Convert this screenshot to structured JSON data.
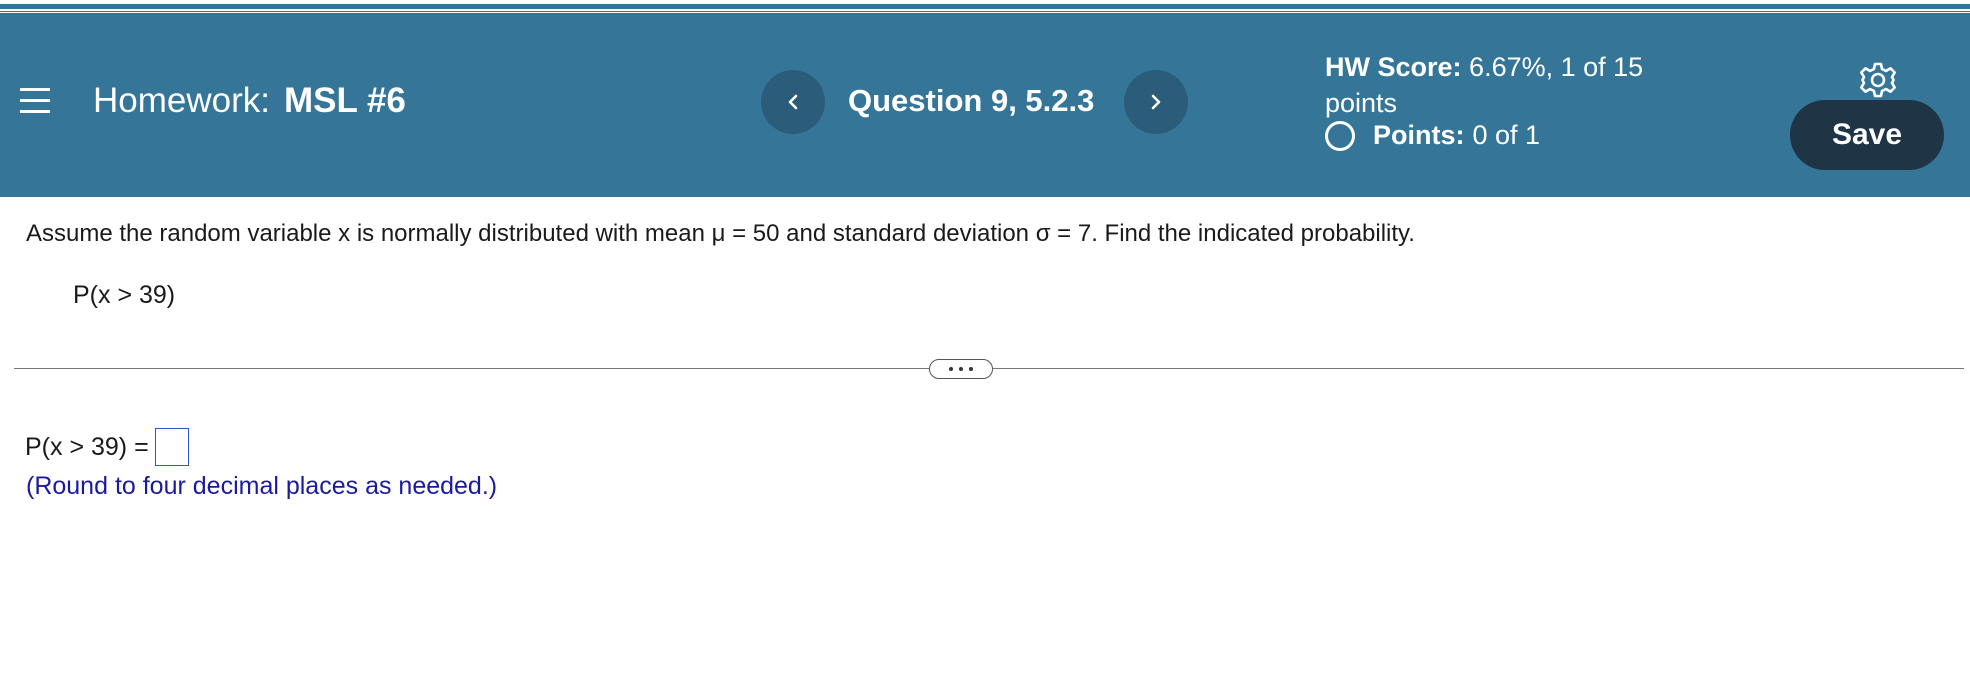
{
  "header": {
    "hw_label": "Homework:",
    "hw_name": "MSL #6",
    "question": "Question 9, 5.2.3",
    "score_label": "HW Score:",
    "score_value": "6.67%, 1 of 15 points",
    "points_label": "Points:",
    "points_value": "0 of 1",
    "save_label": "Save"
  },
  "problem": {
    "prompt": "Assume the random variable x is normally distributed with mean μ = 50 and standard deviation σ = 7. Find the indicated probability.",
    "given": "P(x > 39)"
  },
  "answer": {
    "expression": "P(x > 39) =",
    "value": "",
    "hint": "(Round to four decimal places as needed.)"
  },
  "colors": {
    "header_bg": "#357698",
    "nav_button_bg": "#2b5d7b",
    "save_button_bg": "#1f3444",
    "hint_text": "#1a1a9e",
    "answer_box_border": "#2e56c9"
  },
  "icons": {
    "menu": "hamburger-menu-icon",
    "previous": "chevron-left-icon",
    "next": "chevron-right-icon",
    "settings": "gear-icon",
    "points_status": "empty-circle-icon"
  }
}
